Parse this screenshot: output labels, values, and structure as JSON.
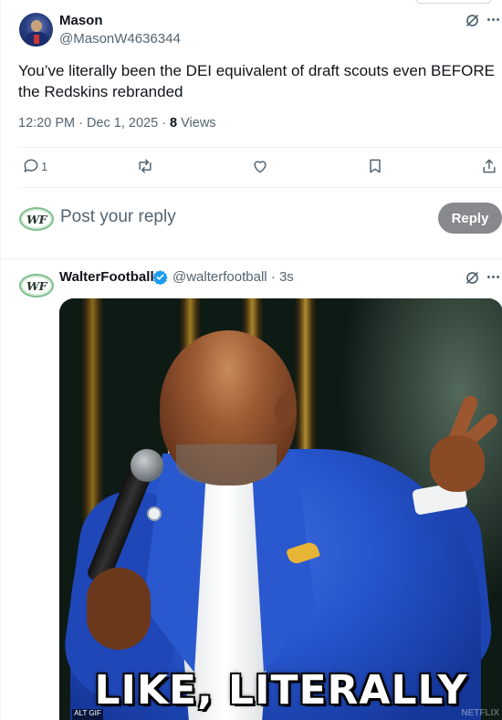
{
  "main_tweet": {
    "author_name": "Mason",
    "author_handle": "@MasonW4636344",
    "text": "You’ve literally been the DEI equivalent of draft scouts even BEFORE the Redskins rebranded",
    "time": "12:20 PM · Dec 1, 2025 · ",
    "views_count": "8",
    "views_label": " Views",
    "reply_count": "1"
  },
  "reply_composer": {
    "avatar_text": "WF",
    "placeholder": "Post your reply",
    "button_label": "Reply"
  },
  "reply_tweet": {
    "author_name": "WalterFootball",
    "author_handle": "@walterfootball · 3s",
    "avatar_text": "WF",
    "media_caption": "LIKE, LITERALLY",
    "media_watermark": "NETFLIX",
    "media_corner_label": "ALT GIF"
  },
  "icons": {
    "grok": "grok-icon",
    "more": "more-icon",
    "reply": "reply-icon",
    "repost": "repost-icon",
    "like": "like-icon",
    "bookmark": "bookmark-icon",
    "share": "share-icon",
    "verified": "verified-badge-icon"
  },
  "colors": {
    "text_primary": "#0f1419",
    "text_secondary": "#536471",
    "divider": "#eff3f4",
    "reply_button": "#87898c",
    "verified_blue": "#1d9bf0"
  }
}
